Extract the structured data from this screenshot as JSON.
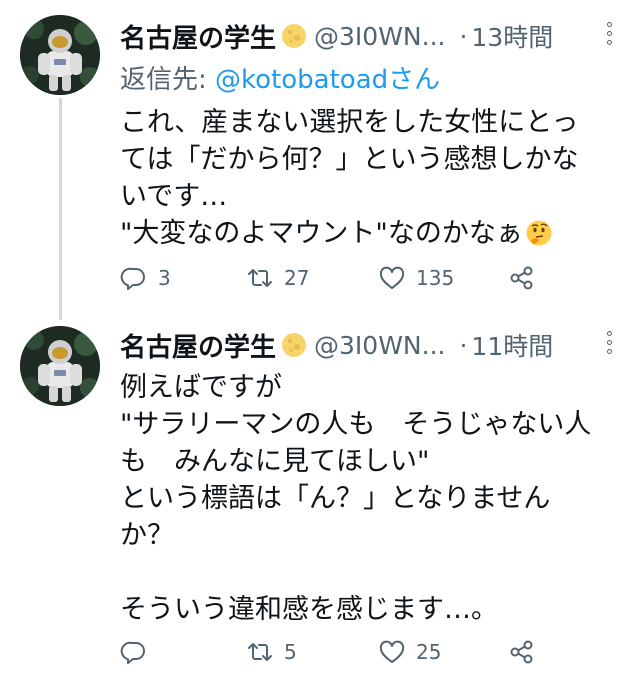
{
  "tweets": [
    {
      "author_name": "名古屋の学生",
      "handle": "@3I0WN...",
      "time": "13時間",
      "reply_prefix": "返信先:",
      "reply_to": "@kotobatoad",
      "reply_suffix": "さん",
      "lines": [
        "これ、産まない選択をした女性にとっ",
        "ては「だから何？」という感想しかな",
        "いです…",
        "\"大変なのよマウント\"なのかなぁ"
      ],
      "reply_count": "3",
      "retweet_count": "27",
      "like_count": "135"
    },
    {
      "author_name": "名古屋の学生",
      "handle": "@3I0WN...",
      "time": "11時間",
      "lines": [
        "例えばですが",
        "\"サラリーマンの人も　そうじゃない人",
        "も　みんなに見てほしい\"",
        "という標語は「ん？」となりません",
        "か？",
        " ",
        "そういう違和感を感じます…。"
      ],
      "reply_count": "",
      "retweet_count": "5",
      "like_count": "25"
    }
  ],
  "colors": {
    "secondary_text": "#536471",
    "link": "#1d9bf0",
    "badge": "#f7d36b",
    "thread_line": "#cfd9de"
  },
  "icons": {
    "badge": "moon-badge-icon",
    "emoji": "thinking-face-emoji",
    "more": "more-vertical-icon",
    "reply": "reply-icon",
    "retweet": "retweet-icon",
    "like": "like-icon",
    "share": "share-icon"
  }
}
